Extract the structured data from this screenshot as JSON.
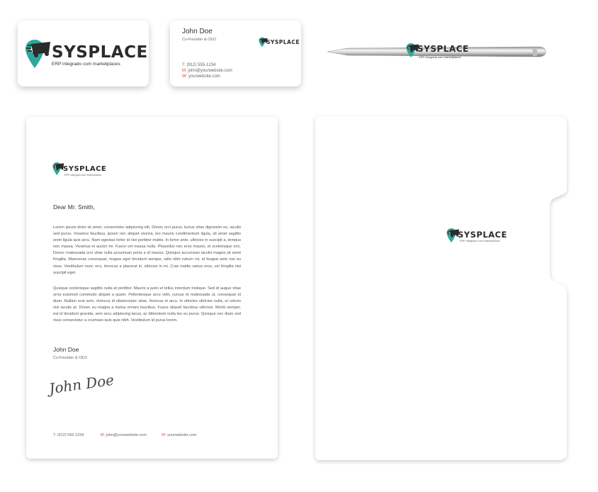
{
  "brand": {
    "name": "SYSPLACE",
    "tagline": "ERP integrado com marketplaces",
    "accent_teal": "#2fa79b",
    "accent_red": "#e24a36",
    "logo_icon": "map-pin-truck-icon"
  },
  "contact": {
    "name": "John Doe",
    "role": "Co-Founder & CEO",
    "phone_label": "T:",
    "phone": "(912) 555-1234",
    "email_label": "M:",
    "email": "john@yourwebsite.com",
    "web_label": "W:",
    "web": "yourwebsite.com"
  },
  "letter": {
    "salutation": "Dear Mr. Smith,",
    "paragraph1": "Lorem ipsum dolor sit amet, consectetur adipiscing elit. Donec orci purus, luctus vitae dignissim eu, iaculis sed purus. Vivamus faucibus, ipsum nec aliquet viverra, leo mauris condimentum ligula, sit amet sagittis enim ligula quis arcu. Nam egestas tortor id nisi porttitor mattis. In tortor ante, ultricies in suscipit a, tempus non massa. Vivamus et auctor mi. Fusce vel massa nulla. Phasellus nec eros mauris, et scelerisque orci. Donec malesuada orci vitae nulla accumsan porta a id massa. Quisque accumsan iaculis magna sit amet fringilla. Maecenas consequat, magna eget tincidunt semper, odio nibh rutrum mi, id feugiat ante nisi eu risus. Vestibulum nunc orci, rhoncus a placerat in, ultricies in mi. Cras mattis varius eros, vel fringilla nisi suscipit eget.",
    "paragraph2": "Quisque scelerisque sagittis nulla at porttitor. Mauris a justo et tellus interdum tristique. Sed id augue vitae urna euismod commodo aliquet a quam. Pellentesque arcu velit, cursus et malesuada ut, consequat et diam. Nullam erat sem, rhoncus id ullamcorper vitae, rhoncus et arcu. In ultricies ultricies nulla, ut rutrum nisi iaculis at. Donec eu magna a metus ornare faucibus. Fusce aliquet faucibus ultricies. Morbi semper, est id tincidunt gravida, sem arcu adipiscing lacus, ac bibendum nulla leo eu purus. Quisque nec diam sed risus consectetur a ccumsan quis quis nibh. Vestibulum id purus lorem.",
    "signature": "John Doe"
  }
}
